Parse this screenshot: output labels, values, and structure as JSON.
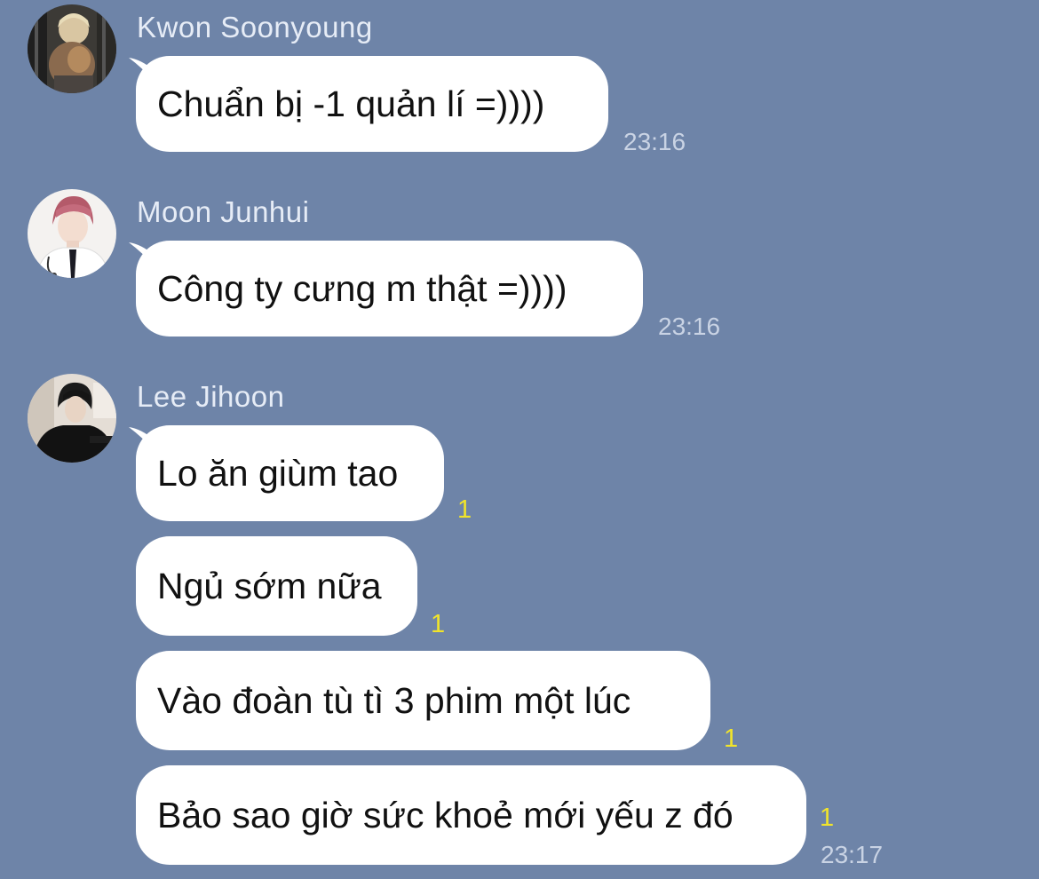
{
  "messages": [
    {
      "sender": "Kwon Soonyoung",
      "avatar": "profile-photo",
      "bubbles": [
        {
          "text": "Chuẩn bị -1 quản lí =))))",
          "unread": "",
          "time": "23:16"
        }
      ]
    },
    {
      "sender": "Moon Junhui",
      "avatar": "profile-photo",
      "bubbles": [
        {
          "text": "Công ty cưng m thật =))))",
          "unread": "",
          "time": "23:16"
        }
      ]
    },
    {
      "sender": "Lee Jihoon",
      "avatar": "profile-photo",
      "bubbles": [
        {
          "text": "Lo ăn giùm tao",
          "unread": "1",
          "time": ""
        },
        {
          "text": "Ngủ sớm nữa",
          "unread": "1",
          "time": ""
        },
        {
          "text": "Vào đoàn tù tì 3 phim một lúc",
          "unread": "1",
          "time": ""
        },
        {
          "text": "Bảo sao giờ sức khoẻ mới yếu z đó",
          "unread": "1",
          "time": "23:17"
        }
      ]
    }
  ],
  "colors": {
    "background": "#6e84a8",
    "bubble": "#ffffff",
    "sender_name": "#e6ecf6",
    "timestamp": "#c9d3e4",
    "unread_count": "#f1e42a"
  }
}
